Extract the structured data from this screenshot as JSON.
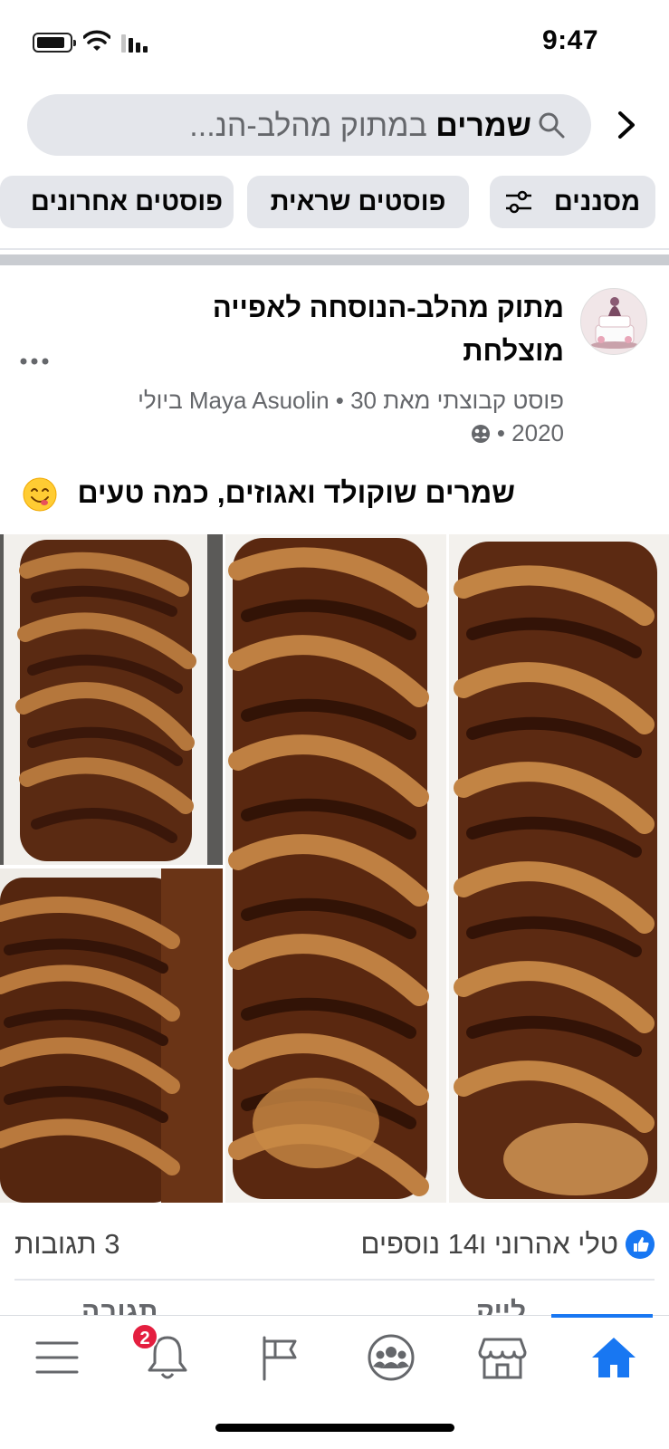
{
  "status_bar": {
    "time": "9:47"
  },
  "search": {
    "query_bold": "שמרים",
    "query_rest": " במתוק מהלב-הנ...",
    "icons": {
      "search": "search-icon",
      "forward": "chevron-right-icon"
    }
  },
  "filters": [
    {
      "label": "מסננים",
      "icon": "filter-sliders-icon"
    },
    {
      "label": "פוסטים שראית"
    },
    {
      "label": "פוסטים אחרונים"
    }
  ],
  "post": {
    "group_name": "מתוק מהלב-הנוסחה לאפייה מוצלחת",
    "meta_line1": "פוסט קבוצתי מאת Maya Asuolin • 30 ביולי",
    "meta_line2": "2020 • ",
    "text": "שמרים שוקולד ואגוזים, כמה טעים",
    "photos_alt": [
      "babka-photo-1",
      "babka-photo-2",
      "babka-photo-3",
      "babka-photo-4"
    ],
    "reactions_text": "טלי אהרוני ו14 נוספים",
    "comments_text": "3 תגובות",
    "actions": {
      "like": "לייק",
      "comment": "תגובה"
    }
  },
  "bottom_nav": {
    "items": [
      "home",
      "marketplace",
      "groups",
      "pages",
      "notifications",
      "menu"
    ],
    "notifications_badge": "2"
  },
  "colors": {
    "accent": "#1877f2",
    "badge": "#e41e3f",
    "chip_bg": "#e4e6eb"
  }
}
